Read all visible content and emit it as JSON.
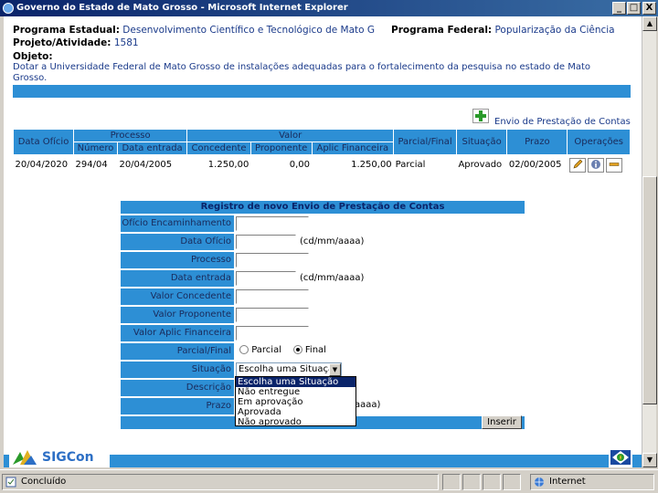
{
  "window": {
    "title": "Governo do Estado de Mato Grosso - Microsoft Internet Explorer",
    "minimize": "_",
    "maximize": "□",
    "close": "X"
  },
  "header": {
    "prog_estadual_label": "Programa Estadual:",
    "prog_estadual_value": "Desenvolvimento Científico e Tecnológico de Mato G",
    "prog_federal_label": "Programa Federal:",
    "prog_federal_value": "Popularização da Ciência",
    "projeto_label": "Projeto/Atividade:",
    "projeto_value": "1581",
    "objeto_label": "Objeto:",
    "objeto_value": "Dotar a Universidade Federal de Mato Grosso de instalações adequadas para o fortalecimento da pesquisa no estado de Mato Grosso."
  },
  "envio": {
    "link_label": "Envio de Prestação de Contas"
  },
  "table": {
    "group_processo": "Processo",
    "group_valor": "Valor",
    "headers": {
      "data_oficio": "Data Ofício",
      "numero": "Número",
      "data_entrada": "Data entrada",
      "concedente": "Concedente",
      "proponente": "Proponente",
      "aplic_financeira": "Aplic Financeira",
      "parcial_final": "Parcial/Final",
      "situacao": "Situação",
      "prazo": "Prazo",
      "operacoes": "Operações"
    },
    "row": {
      "data_oficio": "20/04/2020",
      "numero": "294/04",
      "data_entrada": "20/04/2005",
      "concedente": "1.250,00",
      "proponente": "0,00",
      "aplic_financeira": "1.250,00",
      "parcial_final": "Parcial",
      "situacao": "Aprovado",
      "prazo": "02/00/2005"
    }
  },
  "form": {
    "title": "Registro de novo Envio de Prestação de Contas",
    "labels": {
      "oficio": "Ofício Encaminhamento",
      "data_oficio": "Data Ofício",
      "processo": "Processo",
      "data_entrada": "Data entrada",
      "valor_concedente": "Valor Concedente",
      "valor_proponente": "Valor Proponente",
      "valor_aplic": "Valor Aplic Financeira",
      "parcial_final": "Parcial/Final",
      "situacao": "Situação",
      "descricao": "Descrição",
      "prazo": "Prazo"
    },
    "date_hint": "(cd/mm/aaaa)",
    "date_hint_partial": "aaaa)",
    "radio_parcial": "Parcial",
    "radio_final": "Final",
    "situacao_selected": "Escolha uma Situação",
    "situacao_options": [
      "Escolha uma Situação",
      "Não entregue",
      "Em aprovação",
      "Aprovada",
      "Não aprovado"
    ],
    "submit_label": "Inserir"
  },
  "footer": {
    "logo_text": "SIGCon"
  },
  "status": {
    "left": "Concluído",
    "zone": "Internet"
  }
}
